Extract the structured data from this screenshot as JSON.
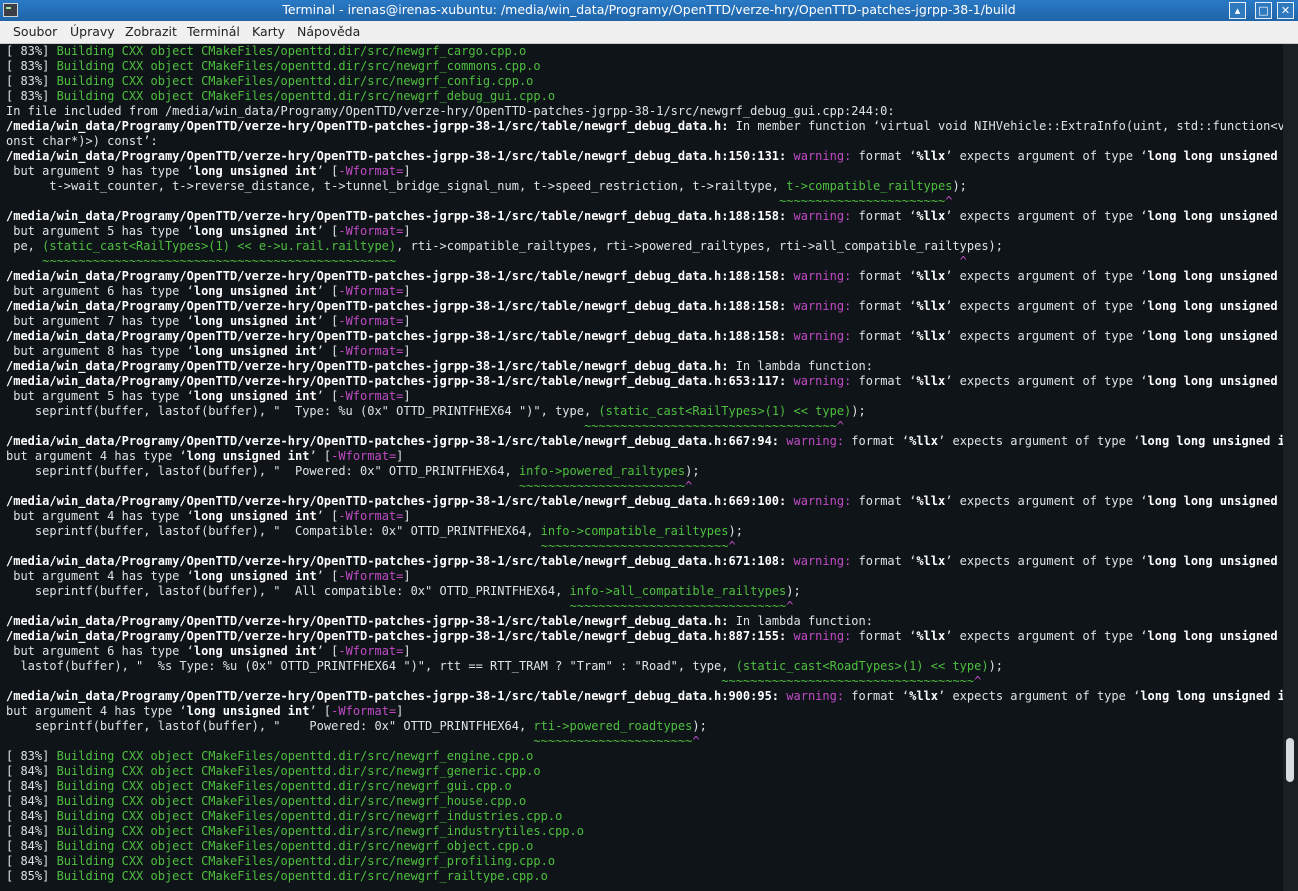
{
  "window": {
    "title": "Terminal - irenas@irenas-xubuntu: /media/win_data/Programy/OpenTTD/verze-hry/OpenTTD-patches-jgrpp-38-1/build"
  },
  "menu": [
    "Soubor",
    "Úpravy",
    "Zobrazit",
    "Terminál",
    "Karty",
    "Nápověda"
  ],
  "terminal": {
    "lines": [
      [
        [
          "[ 83%] ",
          "n"
        ],
        [
          "Building CXX object CMakeFiles/openttd.dir/src/newgrf_cargo.cpp.o",
          "g"
        ]
      ],
      [
        [
          "[ 83%] ",
          "n"
        ],
        [
          "Building CXX object CMakeFiles/openttd.dir/src/newgrf_commons.cpp.o",
          "g"
        ]
      ],
      [
        [
          "[ 83%] ",
          "n"
        ],
        [
          "Building CXX object CMakeFiles/openttd.dir/src/newgrf_config.cpp.o",
          "g"
        ]
      ],
      [
        [
          "[ 83%] ",
          "n"
        ],
        [
          "Building CXX object CMakeFiles/openttd.dir/src/newgrf_debug_gui.cpp.o",
          "g"
        ]
      ],
      [
        [
          "In file included from /media/win_data/Programy/OpenTTD/verze-hry/OpenTTD-patches-jgrpp-38-1/src/newgrf_debug_gui.cpp:244:0:",
          "n"
        ]
      ],
      [
        [
          "/media/win_data/Programy/OpenTTD/verze-hry/OpenTTD-patches-jgrpp-38-1/src/table/newgrf_debug_data.h:",
          "b"
        ],
        [
          " In member function ‘virtual void NIHVehicle::ExtraInfo(uint, std::function<void(c",
          "n"
        ]
      ],
      [
        [
          "onst char*)>) const’:",
          "n"
        ]
      ],
      [
        [
          "/media/win_data/Programy/OpenTTD/verze-hry/OpenTTD-patches-jgrpp-38-1/src/table/newgrf_debug_data.h:150:131:",
          "b"
        ],
        [
          " ",
          "n"
        ],
        [
          "warning:",
          "m"
        ],
        [
          " format ‘",
          "n"
        ],
        [
          "%llx",
          "b"
        ],
        [
          "’ expects argument of type ‘",
          "n"
        ],
        [
          "long long unsigned int",
          "b"
        ],
        [
          "’,",
          "n"
        ]
      ],
      [
        [
          " but argument 9 has type ‘",
          "n"
        ],
        [
          "long unsigned int",
          "b"
        ],
        [
          "’ [",
          "n"
        ],
        [
          "-Wformat=",
          "m"
        ],
        [
          "]",
          "n"
        ]
      ],
      [
        [
          "      t->wait_counter, t->reverse_distance, t->tunnel_bridge_signal_num, t->speed_restriction, t->railtype, ",
          "n"
        ],
        [
          "t->compatible_railtypes",
          "g"
        ],
        [
          ");",
          "n"
        ]
      ],
      [
        [
          "                                                                                                           ",
          "n"
        ],
        [
          "~~~~~~~~~~~~~~~~~~~~~~~",
          "g"
        ],
        [
          "^",
          "m"
        ]
      ],
      [
        [
          "/media/win_data/Programy/OpenTTD/verze-hry/OpenTTD-patches-jgrpp-38-1/src/table/newgrf_debug_data.h:188:158:",
          "b"
        ],
        [
          " ",
          "n"
        ],
        [
          "warning:",
          "m"
        ],
        [
          " format ‘",
          "n"
        ],
        [
          "%llx",
          "b"
        ],
        [
          "’ expects argument of type ‘",
          "n"
        ],
        [
          "long long unsigned int",
          "b"
        ],
        [
          "’,",
          "n"
        ]
      ],
      [
        [
          " but argument 5 has type ‘",
          "n"
        ],
        [
          "long unsigned int",
          "b"
        ],
        [
          "’ [",
          "n"
        ],
        [
          "-Wformat=",
          "m"
        ],
        [
          "]",
          "n"
        ]
      ],
      [
        [
          " pe, ",
          "n"
        ],
        [
          "(static_cast<RailTypes>(1) << e->u.rail.railtype)",
          "g"
        ],
        [
          ", rti->compatible_railtypes, rti->powered_railtypes, rti->all_compatible_railtypes);",
          "n"
        ]
      ],
      [
        [
          "     ",
          "n"
        ],
        [
          "~~~~~~~~~~~~~~~~~~~~~~~~~~~~~~~~~~~~~~~~~~~~~~~~~",
          "g"
        ],
        [
          "                                                                              ",
          "n"
        ],
        [
          "^",
          "m"
        ]
      ],
      [
        [
          "/media/win_data/Programy/OpenTTD/verze-hry/OpenTTD-patches-jgrpp-38-1/src/table/newgrf_debug_data.h:188:158:",
          "b"
        ],
        [
          " ",
          "n"
        ],
        [
          "warning:",
          "m"
        ],
        [
          " format ‘",
          "n"
        ],
        [
          "%llx",
          "b"
        ],
        [
          "’ expects argument of type ‘",
          "n"
        ],
        [
          "long long unsigned int",
          "b"
        ],
        [
          "’,",
          "n"
        ]
      ],
      [
        [
          " but argument 6 has type ‘",
          "n"
        ],
        [
          "long unsigned int",
          "b"
        ],
        [
          "’ [",
          "n"
        ],
        [
          "-Wformat=",
          "m"
        ],
        [
          "]",
          "n"
        ]
      ],
      [
        [
          "/media/win_data/Programy/OpenTTD/verze-hry/OpenTTD-patches-jgrpp-38-1/src/table/newgrf_debug_data.h:188:158:",
          "b"
        ],
        [
          " ",
          "n"
        ],
        [
          "warning:",
          "m"
        ],
        [
          " format ‘",
          "n"
        ],
        [
          "%llx",
          "b"
        ],
        [
          "’ expects argument of type ‘",
          "n"
        ],
        [
          "long long unsigned int",
          "b"
        ],
        [
          "’,",
          "n"
        ]
      ],
      [
        [
          " but argument 7 has type ‘",
          "n"
        ],
        [
          "long unsigned int",
          "b"
        ],
        [
          "’ [",
          "n"
        ],
        [
          "-Wformat=",
          "m"
        ],
        [
          "]",
          "n"
        ]
      ],
      [
        [
          "/media/win_data/Programy/OpenTTD/verze-hry/OpenTTD-patches-jgrpp-38-1/src/table/newgrf_debug_data.h:188:158:",
          "b"
        ],
        [
          " ",
          "n"
        ],
        [
          "warning:",
          "m"
        ],
        [
          " format ‘",
          "n"
        ],
        [
          "%llx",
          "b"
        ],
        [
          "’ expects argument of type ‘",
          "n"
        ],
        [
          "long long unsigned int",
          "b"
        ],
        [
          "’,",
          "n"
        ]
      ],
      [
        [
          " but argument 8 has type ‘",
          "n"
        ],
        [
          "long unsigned int",
          "b"
        ],
        [
          "’ [",
          "n"
        ],
        [
          "-Wformat=",
          "m"
        ],
        [
          "]",
          "n"
        ]
      ],
      [
        [
          "/media/win_data/Programy/OpenTTD/verze-hry/OpenTTD-patches-jgrpp-38-1/src/table/newgrf_debug_data.h:",
          "b"
        ],
        [
          " In lambda function:",
          "n"
        ]
      ],
      [
        [
          "/media/win_data/Programy/OpenTTD/verze-hry/OpenTTD-patches-jgrpp-38-1/src/table/newgrf_debug_data.h:653:117:",
          "b"
        ],
        [
          " ",
          "n"
        ],
        [
          "warning:",
          "m"
        ],
        [
          " format ‘",
          "n"
        ],
        [
          "%llx",
          "b"
        ],
        [
          "’ expects argument of type ‘",
          "n"
        ],
        [
          "long long unsigned int",
          "b"
        ],
        [
          "’,",
          "n"
        ]
      ],
      [
        [
          " but argument 5 has type ‘",
          "n"
        ],
        [
          "long unsigned int",
          "b"
        ],
        [
          "’ [",
          "n"
        ],
        [
          "-Wformat=",
          "m"
        ],
        [
          "]",
          "n"
        ]
      ],
      [
        [
          "    seprintf(buffer, lastof(buffer), \"  Type: %u (0x\" OTTD_PRINTFHEX64 \")\", type, ",
          "n"
        ],
        [
          "(static_cast<RailTypes>(1) << type)",
          "g"
        ],
        [
          ");",
          "n"
        ]
      ],
      [
        [
          "                                                                                ",
          "n"
        ],
        [
          "~~~~~~~~~~~~~~~~~~~~~~~~~~~~~~~~~~~",
          "g"
        ],
        [
          "^",
          "m"
        ]
      ],
      [
        [
          "/media/win_data/Programy/OpenTTD/verze-hry/OpenTTD-patches-jgrpp-38-1/src/table/newgrf_debug_data.h:667:94:",
          "b"
        ],
        [
          " ",
          "n"
        ],
        [
          "warning:",
          "m"
        ],
        [
          " format ‘",
          "n"
        ],
        [
          "%llx",
          "b"
        ],
        [
          "’ expects argument of type ‘",
          "n"
        ],
        [
          "long long unsigned int",
          "b"
        ],
        [
          "’,",
          "n"
        ]
      ],
      [
        [
          "but argument 4 has type ‘",
          "n"
        ],
        [
          "long unsigned int",
          "b"
        ],
        [
          "’ [",
          "n"
        ],
        [
          "-Wformat=",
          "m"
        ],
        [
          "]",
          "n"
        ]
      ],
      [
        [
          "    seprintf(buffer, lastof(buffer), \"  Powered: 0x\" OTTD_PRINTFHEX64, ",
          "n"
        ],
        [
          "info->powered_railtypes",
          "g"
        ],
        [
          ");",
          "n"
        ]
      ],
      [
        [
          "                                                                       ",
          "n"
        ],
        [
          "~~~~~~~~~~~~~~~~~~~~~~~",
          "g"
        ],
        [
          "^",
          "m"
        ]
      ],
      [
        [
          "/media/win_data/Programy/OpenTTD/verze-hry/OpenTTD-patches-jgrpp-38-1/src/table/newgrf_debug_data.h:669:100:",
          "b"
        ],
        [
          " ",
          "n"
        ],
        [
          "warning:",
          "m"
        ],
        [
          " format ‘",
          "n"
        ],
        [
          "%llx",
          "b"
        ],
        [
          "’ expects argument of type ‘",
          "n"
        ],
        [
          "long long unsigned int",
          "b"
        ],
        [
          "’,",
          "n"
        ]
      ],
      [
        [
          " but argument 4 has type ‘",
          "n"
        ],
        [
          "long unsigned int",
          "b"
        ],
        [
          "’ [",
          "n"
        ],
        [
          "-Wformat=",
          "m"
        ],
        [
          "]",
          "n"
        ]
      ],
      [
        [
          "    seprintf(buffer, lastof(buffer), \"  Compatible: 0x\" OTTD_PRINTFHEX64, ",
          "n"
        ],
        [
          "info->compatible_railtypes",
          "g"
        ],
        [
          ");",
          "n"
        ]
      ],
      [
        [
          "                                                                          ",
          "n"
        ],
        [
          "~~~~~~~~~~~~~~~~~~~~~~~~~~",
          "g"
        ],
        [
          "^",
          "m"
        ]
      ],
      [
        [
          "/media/win_data/Programy/OpenTTD/verze-hry/OpenTTD-patches-jgrpp-38-1/src/table/newgrf_debug_data.h:671:108:",
          "b"
        ],
        [
          " ",
          "n"
        ],
        [
          "warning:",
          "m"
        ],
        [
          " format ‘",
          "n"
        ],
        [
          "%llx",
          "b"
        ],
        [
          "’ expects argument of type ‘",
          "n"
        ],
        [
          "long long unsigned int",
          "b"
        ],
        [
          "’,",
          "n"
        ]
      ],
      [
        [
          " but argument 4 has type ‘",
          "n"
        ],
        [
          "long unsigned int",
          "b"
        ],
        [
          "’ [",
          "n"
        ],
        [
          "-Wformat=",
          "m"
        ],
        [
          "]",
          "n"
        ]
      ],
      [
        [
          "    seprintf(buffer, lastof(buffer), \"  All compatible: 0x\" OTTD_PRINTFHEX64, ",
          "n"
        ],
        [
          "info->all_compatible_railtypes",
          "g"
        ],
        [
          ");",
          "n"
        ]
      ],
      [
        [
          "                                                                              ",
          "n"
        ],
        [
          "~~~~~~~~~~~~~~~~~~~~~~~~~~~~~~",
          "g"
        ],
        [
          "^",
          "m"
        ]
      ],
      [
        [
          "/media/win_data/Programy/OpenTTD/verze-hry/OpenTTD-patches-jgrpp-38-1/src/table/newgrf_debug_data.h:",
          "b"
        ],
        [
          " In lambda function:",
          "n"
        ]
      ],
      [
        [
          "/media/win_data/Programy/OpenTTD/verze-hry/OpenTTD-patches-jgrpp-38-1/src/table/newgrf_debug_data.h:887:155:",
          "b"
        ],
        [
          " ",
          "n"
        ],
        [
          "warning:",
          "m"
        ],
        [
          " format ‘",
          "n"
        ],
        [
          "%llx",
          "b"
        ],
        [
          "’ expects argument of type ‘",
          "n"
        ],
        [
          "long long unsigned int",
          "b"
        ],
        [
          "’,",
          "n"
        ]
      ],
      [
        [
          " but argument 6 has type ‘",
          "n"
        ],
        [
          "long unsigned int",
          "b"
        ],
        [
          "’ [",
          "n"
        ],
        [
          "-Wformat=",
          "m"
        ],
        [
          "]",
          "n"
        ]
      ],
      [
        [
          "  lastof(buffer), \"  %s Type: %u (0x\" OTTD_PRINTFHEX64 \")\", rtt == RTT_TRAM ? \"Tram\" : \"Road\", type, ",
          "n"
        ],
        [
          "(static_cast<RoadTypes>(1) << type)",
          "g"
        ],
        [
          ");",
          "n"
        ]
      ],
      [
        [
          "                                                                                                   ",
          "n"
        ],
        [
          "~~~~~~~~~~~~~~~~~~~~~~~~~~~~~~~~~~~",
          "g"
        ],
        [
          "^",
          "m"
        ]
      ],
      [
        [
          "/media/win_data/Programy/OpenTTD/verze-hry/OpenTTD-patches-jgrpp-38-1/src/table/newgrf_debug_data.h:900:95:",
          "b"
        ],
        [
          " ",
          "n"
        ],
        [
          "warning:",
          "m"
        ],
        [
          " format ‘",
          "n"
        ],
        [
          "%llx",
          "b"
        ],
        [
          "’ expects argument of type ‘",
          "n"
        ],
        [
          "long long unsigned int",
          "b"
        ],
        [
          "’,",
          "n"
        ]
      ],
      [
        [
          "but argument 4 has type ‘",
          "n"
        ],
        [
          "long unsigned int",
          "b"
        ],
        [
          "’ [",
          "n"
        ],
        [
          "-Wformat=",
          "m"
        ],
        [
          "]",
          "n"
        ]
      ],
      [
        [
          "    seprintf(buffer, lastof(buffer), \"    Powered: 0x\" OTTD_PRINTFHEX64, ",
          "n"
        ],
        [
          "rti->powered_roadtypes",
          "g"
        ],
        [
          ");",
          "n"
        ]
      ],
      [
        [
          "                                                                         ",
          "n"
        ],
        [
          "~~~~~~~~~~~~~~~~~~~~~~",
          "g"
        ],
        [
          "^",
          "m"
        ]
      ],
      [
        [
          "[ 83%] ",
          "n"
        ],
        [
          "Building CXX object CMakeFiles/openttd.dir/src/newgrf_engine.cpp.o",
          "g"
        ]
      ],
      [
        [
          "[ 84%] ",
          "n"
        ],
        [
          "Building CXX object CMakeFiles/openttd.dir/src/newgrf_generic.cpp.o",
          "g"
        ]
      ],
      [
        [
          "[ 84%] ",
          "n"
        ],
        [
          "Building CXX object CMakeFiles/openttd.dir/src/newgrf_gui.cpp.o",
          "g"
        ]
      ],
      [
        [
          "[ 84%] ",
          "n"
        ],
        [
          "Building CXX object CMakeFiles/openttd.dir/src/newgrf_house.cpp.o",
          "g"
        ]
      ],
      [
        [
          "[ 84%] ",
          "n"
        ],
        [
          "Building CXX object CMakeFiles/openttd.dir/src/newgrf_industries.cpp.o",
          "g"
        ]
      ],
      [
        [
          "[ 84%] ",
          "n"
        ],
        [
          "Building CXX object CMakeFiles/openttd.dir/src/newgrf_industrytiles.cpp.o",
          "g"
        ]
      ],
      [
        [
          "[ 84%] ",
          "n"
        ],
        [
          "Building CXX object CMakeFiles/openttd.dir/src/newgrf_object.cpp.o",
          "g"
        ]
      ],
      [
        [
          "[ 84%] ",
          "n"
        ],
        [
          "Building CXX object CMakeFiles/openttd.dir/src/newgrf_profiling.cpp.o",
          "g"
        ]
      ],
      [
        [
          "[ 85%] ",
          "n"
        ],
        [
          "Building CXX object CMakeFiles/openttd.dir/src/newgrf_railtype.cpp.o",
          "g"
        ]
      ]
    ]
  }
}
